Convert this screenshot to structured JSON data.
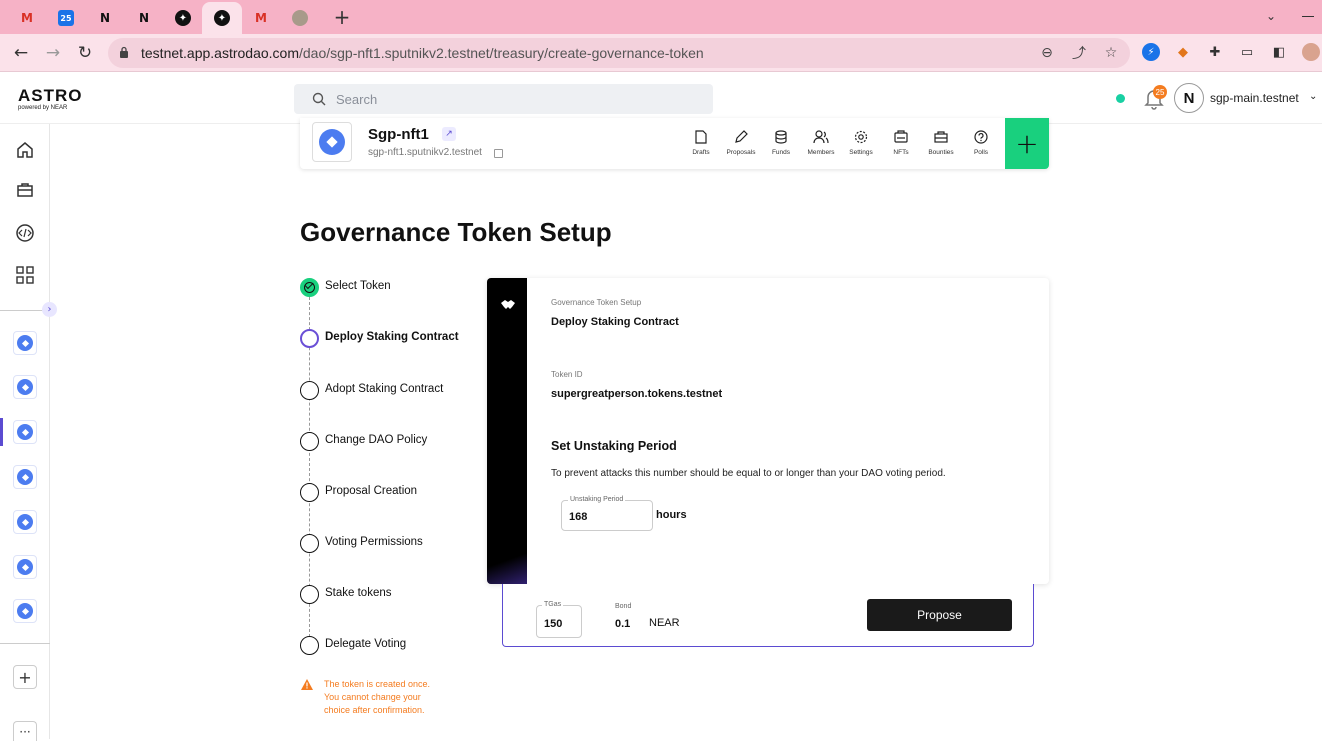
{
  "browser": {
    "tabs": [
      {
        "icon": "gmail-icon",
        "glyph": "M",
        "color": "#d93025"
      },
      {
        "icon": "calendar-icon",
        "glyph": "25",
        "color": "#1a73e8"
      },
      {
        "icon": "near-icon",
        "glyph": "N",
        "color": "#111111"
      },
      {
        "icon": "near-icon",
        "glyph": "N",
        "color": "#111111"
      },
      {
        "icon": "astro-icon",
        "glyph": "✦",
        "color": "#111111"
      },
      {
        "icon": "astro-icon",
        "glyph": "✦",
        "color": "#111111"
      },
      {
        "icon": "gmail-icon",
        "glyph": "M",
        "color": "#d93025"
      },
      {
        "icon": "extension-icon",
        "glyph": "●",
        "color": "#9a8a7a"
      }
    ],
    "new_tab": "+",
    "url_host": "testnet.app.astrodao.com",
    "url_path": "/dao/sgp-nft1.sputnikv2.testnet/treasury/create-governance-token"
  },
  "header": {
    "logo": "ASTRO",
    "logo_sub": "powered by NEAR",
    "search_placeholder": "Search",
    "notifications_count": "25",
    "account_name": "sgp-main.testnet",
    "account_avatar": "N"
  },
  "dao": {
    "name": "Sgp-nft1",
    "id": "sgp-nft1.sputnikv2.testnet",
    "nav": [
      {
        "label": "Drafts",
        "icon": "drafts-icon"
      },
      {
        "label": "Proposals",
        "icon": "pencil-icon"
      },
      {
        "label": "Funds",
        "icon": "coins-icon"
      },
      {
        "label": "Members",
        "icon": "members-icon"
      },
      {
        "label": "Settings",
        "icon": "gear-icon"
      },
      {
        "label": "NFTs",
        "icon": "nft-icon"
      },
      {
        "label": "Bounties",
        "icon": "bounty-icon"
      },
      {
        "label": "Polls",
        "icon": "question-icon"
      }
    ],
    "add_label": "+"
  },
  "page": {
    "title": "Governance Token Setup"
  },
  "steps": [
    {
      "label": "Select Token",
      "state": "done"
    },
    {
      "label": "Deploy Staking Contract",
      "state": "current"
    },
    {
      "label": "Adopt Staking Contract",
      "state": "todo"
    },
    {
      "label": "Change DAO Policy",
      "state": "todo"
    },
    {
      "label": "Proposal Creation",
      "state": "todo"
    },
    {
      "label": "Voting Permissions",
      "state": "todo"
    },
    {
      "label": "Stake tokens",
      "state": "todo"
    },
    {
      "label": "Delegate Voting",
      "state": "todo"
    }
  ],
  "warning": "The token is created once. You cannot change your choice after confirmation.",
  "card": {
    "kicker": "Governance Token Setup",
    "title": "Deploy Staking Contract",
    "token_label": "Token ID",
    "token_value": "supergreatperson.tokens.testnet",
    "section_title": "Set Unstaking Period",
    "section_desc": "To prevent attacks this number should be equal to or longer than your DAO voting period.",
    "period_label": "Unstaking Period",
    "period_value": "168",
    "period_unit": "hours"
  },
  "proposal": {
    "tgas_label": "TGas",
    "tgas_value": "150",
    "bond_label": "Bond",
    "bond_value": "0.1",
    "bond_unit": "NEAR",
    "propose_label": "Propose"
  },
  "colors": {
    "accent": "#5b4bd1",
    "success": "#19d07e",
    "warning": "#f47c20",
    "tab_bar": "#f6b2c6"
  }
}
